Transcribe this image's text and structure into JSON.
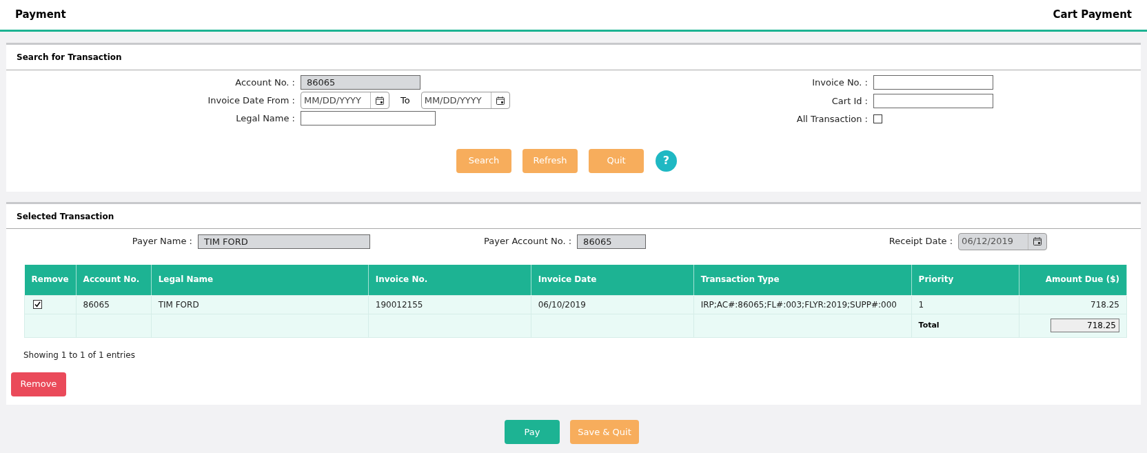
{
  "header": {
    "title": "Payment",
    "breadcrumb": "Cart Payment"
  },
  "search_panel": {
    "title": "Search for Transaction",
    "account_no": {
      "label": "Account No. :",
      "value": "86065",
      "disabled": true
    },
    "invoice_date_from": {
      "label": "Invoice Date From :",
      "placeholder": "MM/DD/YYYY"
    },
    "to": {
      "label": "To",
      "placeholder": "MM/DD/YYYY"
    },
    "legal_name": {
      "label": "Legal Name :"
    },
    "invoice_no": {
      "label": "Invoice No. :"
    },
    "cart_id": {
      "label": "Cart Id :"
    },
    "all_transaction": {
      "label": "All Transaction :",
      "checked": false
    },
    "buttons": [
      "Search",
      "Refresh",
      "Quit"
    ],
    "help": "?"
  },
  "selected_panel": {
    "title": "Selected Transaction",
    "payer_name": {
      "label": "Payer Name :",
      "value": "TIM FORD"
    },
    "payer_account_no": {
      "label": "Payer Account No. :",
      "value": "86065"
    },
    "receipt_date": {
      "label": "Receipt Date :",
      "value": "06/12/2019"
    },
    "table": {
      "columns": [
        "Remove",
        "Account No.",
        "Legal Name",
        "Invoice No.",
        "Invoice Date",
        "Transaction Type",
        "Priority",
        "Amount Due ($)"
      ],
      "rows": [
        {
          "checked": true,
          "cells": [
            "",
            "86065",
            "TIM FORD",
            "190012155",
            "06/10/2019",
            "IRP;AC#:86065;FL#:003;FLYR:2019;SUPP#:000",
            "1",
            "718.25"
          ]
        }
      ],
      "total_label": "Total",
      "total_value": "718.25"
    },
    "info": "Showing 1 to 1 of 1 entries",
    "remove_button": "Remove"
  },
  "footer_buttons": [
    {
      "label": "Pay",
      "kind": "primary"
    },
    {
      "label": "Save & Quit",
      "kind": "secondary"
    }
  ]
}
